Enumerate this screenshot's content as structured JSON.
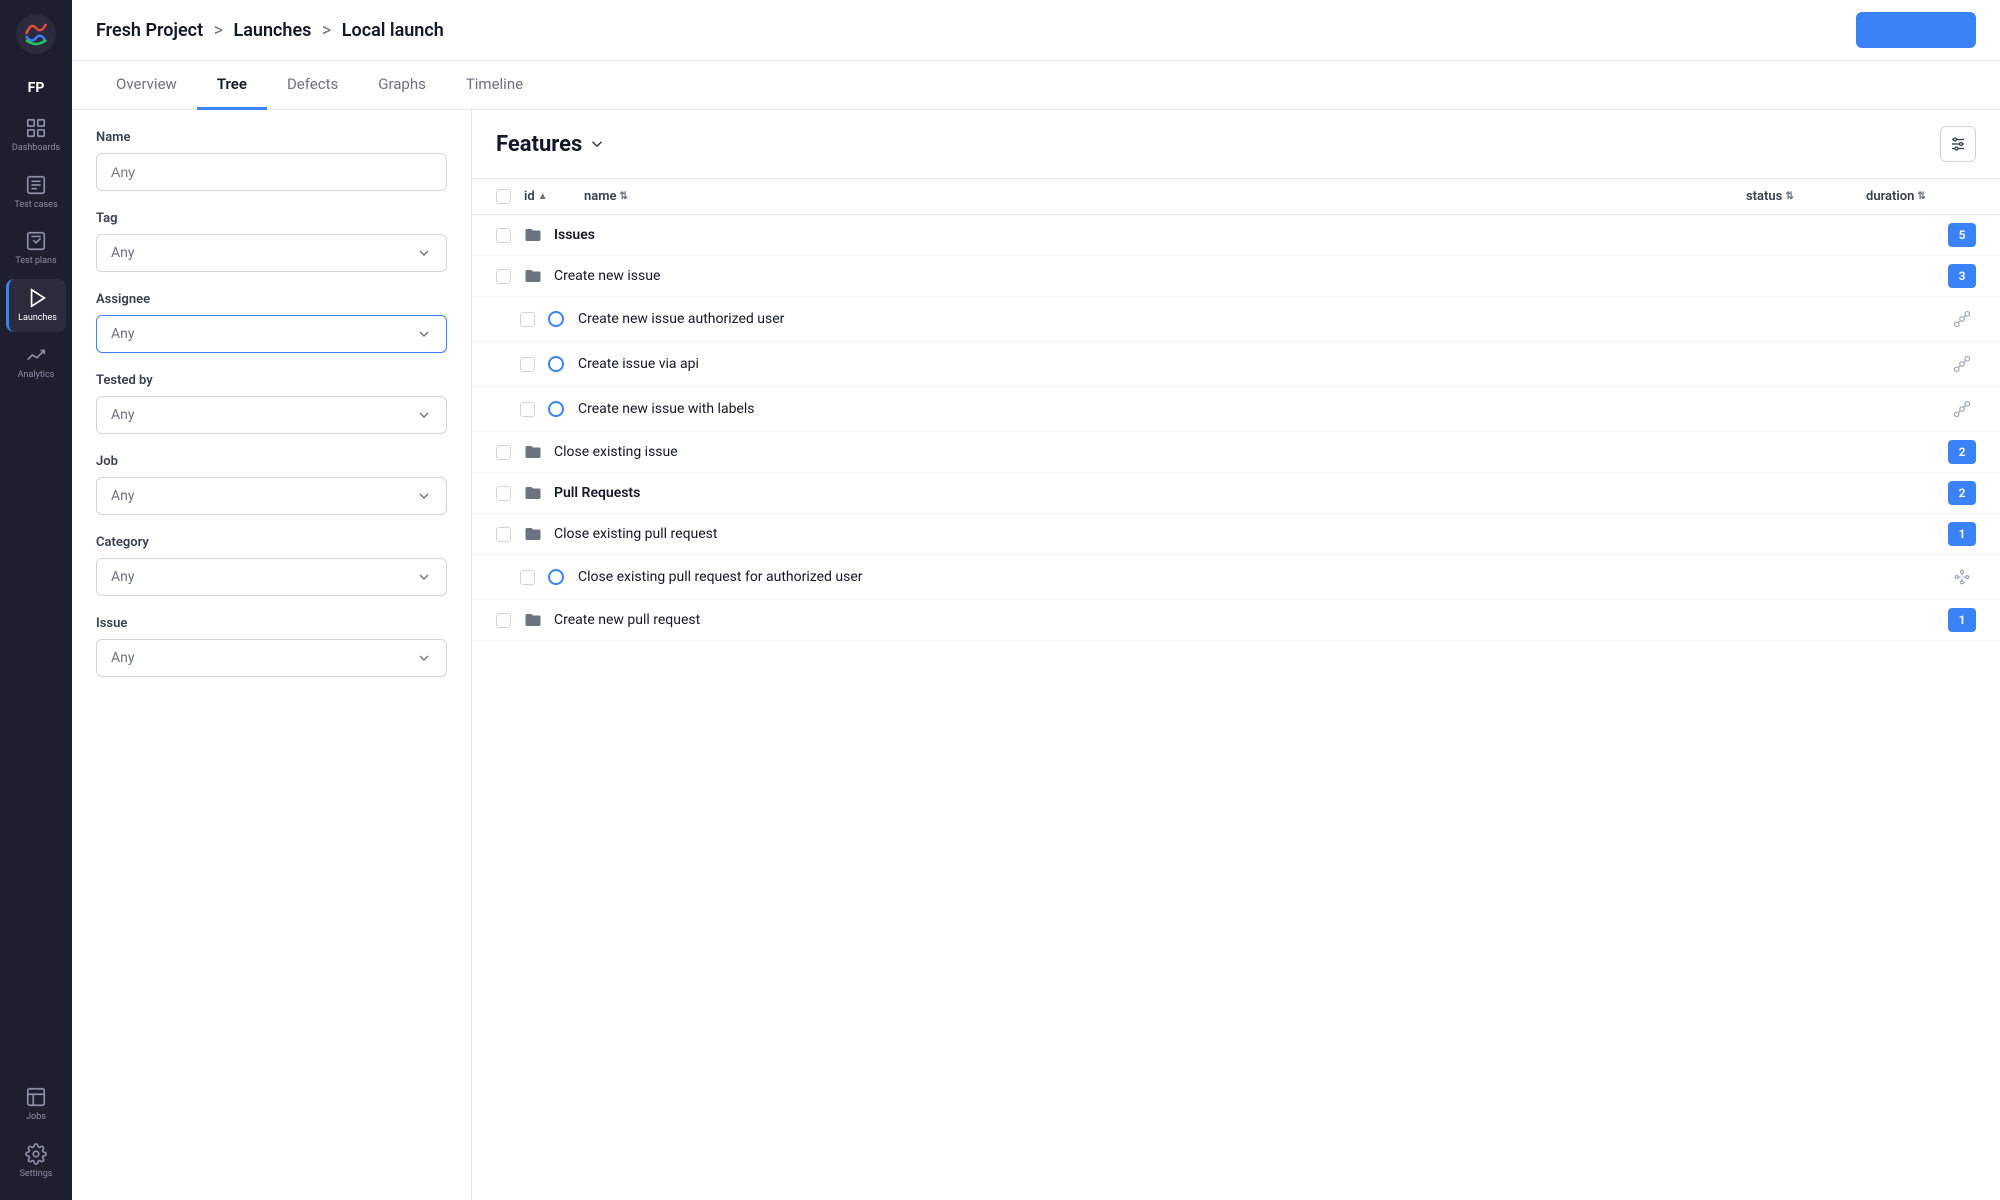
{
  "app": {
    "logo_initials": "FP",
    "header_button_label": ""
  },
  "breadcrumb": {
    "project": "Fresh Project",
    "sep1": ">",
    "launches": "Launches",
    "sep2": ">",
    "current": "Local launch"
  },
  "tabs": [
    {
      "id": "overview",
      "label": "Overview",
      "active": false
    },
    {
      "id": "tree",
      "label": "Tree",
      "active": true
    },
    {
      "id": "defects",
      "label": "Defects",
      "active": false
    },
    {
      "id": "graphs",
      "label": "Graphs",
      "active": false
    },
    {
      "id": "timeline",
      "label": "Timeline",
      "active": false
    }
  ],
  "filters": {
    "name_label": "Name",
    "name_placeholder": "Any",
    "tag_label": "Tag",
    "tag_placeholder": "Any",
    "assignee_label": "Assignee",
    "assignee_placeholder": "Any",
    "tested_by_label": "Tested by",
    "tested_by_placeholder": "Any",
    "job_label": "Job",
    "job_placeholder": "Any",
    "category_label": "Category",
    "category_placeholder": "Any",
    "issue_label": "Issue",
    "issue_placeholder": "Any"
  },
  "sidebar": {
    "items": [
      {
        "id": "dashboards",
        "label": "Dashboards",
        "active": false
      },
      {
        "id": "test-cases",
        "label": "Test cases",
        "active": false
      },
      {
        "id": "test-plans",
        "label": "Test plans",
        "active": false
      },
      {
        "id": "launches",
        "label": "Launches",
        "active": true
      },
      {
        "id": "analytics",
        "label": "Analytics",
        "active": false
      },
      {
        "id": "jobs",
        "label": "Jobs",
        "active": false
      },
      {
        "id": "settings",
        "label": "Settings",
        "active": false
      }
    ]
  },
  "table": {
    "features_title": "Features",
    "columns": [
      "id",
      "name",
      "status",
      "duration"
    ],
    "groups": [
      {
        "id": "issues",
        "name": "Issues",
        "badge": "5",
        "children": [
          {
            "id": "create-new-issue",
            "name": "Create new issue",
            "badge": "3",
            "type": "folder",
            "children": [
              {
                "name": "Create new issue authorized user",
                "type": "test"
              },
              {
                "name": "Create issue via api",
                "type": "test"
              },
              {
                "name": "Create new issue with labels",
                "type": "test"
              }
            ]
          },
          {
            "id": "close-existing-issue",
            "name": "Close existing issue",
            "badge": "2",
            "type": "folder",
            "children": []
          }
        ]
      },
      {
        "id": "pull-requests",
        "name": "Pull Requests",
        "badge": "2",
        "children": [
          {
            "id": "close-existing-pull-request",
            "name": "Close existing pull request",
            "badge": "1",
            "type": "folder",
            "children": [
              {
                "name": "Close existing pull request for authorized user",
                "type": "test"
              }
            ]
          },
          {
            "id": "create-new-pull-request",
            "name": "Create new pull request",
            "badge": "1",
            "type": "folder",
            "children": []
          }
        ]
      }
    ]
  }
}
